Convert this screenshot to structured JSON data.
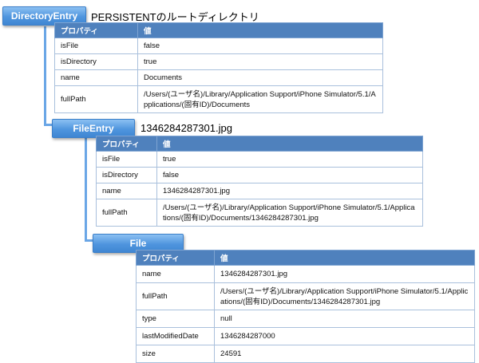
{
  "directory_entry": {
    "badge": "DirectoryEntry",
    "heading": "PERSISTENTのルートディレクトリ",
    "columns": [
      "プロパティ",
      "値"
    ],
    "rows": [
      {
        "prop": "isFile",
        "value": "false"
      },
      {
        "prop": "isDirectory",
        "value": "true"
      },
      {
        "prop": "name",
        "value": "Documents"
      },
      {
        "prop": "fullPath",
        "value": "/Users/(ユーザ名)/Library/Application Support/iPhone Simulator/5.1/Applications/(固有ID)/Documents"
      }
    ]
  },
  "file_entry": {
    "badge": "FileEntry",
    "heading": "1346284287301.jpg",
    "columns": [
      "プロパティ",
      "値"
    ],
    "rows": [
      {
        "prop": "isFile",
        "value": "true"
      },
      {
        "prop": "isDirectory",
        "value": "false"
      },
      {
        "prop": "name",
        "value": "1346284287301.jpg"
      },
      {
        "prop": "fullPath",
        "value": "/Users/(ユーザ名)/Library/Application Support/iPhone Simulator/5.1/Applications/(固有ID)/Documents/1346284287301.jpg"
      }
    ]
  },
  "file": {
    "badge": "File",
    "columns": [
      "プロパティ",
      "値"
    ],
    "rows": [
      {
        "prop": "name",
        "value": "1346284287301.jpg"
      },
      {
        "prop": "fullPath",
        "value": "/Users/(ユーザ名)/Library/Application Support/iPhone Simulator/5.1/Applications/(固有ID)/Documents/1346284287301.jpg"
      },
      {
        "prop": "type",
        "value": "null"
      },
      {
        "prop": "lastModifiedDate",
        "value": "1346284287000"
      },
      {
        "prop": "size",
        "value": "24591"
      }
    ]
  },
  "colors": {
    "badge": "#4f95de",
    "table_header": "#4f81bd",
    "connector": "#6aa6e6"
  }
}
